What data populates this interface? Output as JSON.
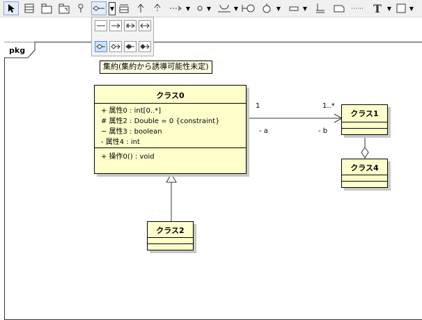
{
  "tooltip": {
    "text": "集約(集約から誘導可能性未定)"
  },
  "diagram": {
    "frame_label": "pkg",
    "classes": [
      {
        "name": "クラス0",
        "attributes": [
          "+ 属性0 : int[0..*]",
          "# 属性2 : Double = 0 {constraint}",
          "~ 属性3 : boolean",
          "- 属性4 : int"
        ],
        "operations": [
          "+ 操作0() : void"
        ]
      },
      {
        "name": "クラス1"
      },
      {
        "name": "クラス4"
      },
      {
        "name": "クラス2"
      }
    ],
    "association": {
      "source_multiplicity": "1",
      "target_multiplicity": "1..*",
      "source_role": "- a",
      "target_role": "- b"
    }
  },
  "colors": {
    "class_fill": "#ffffcc",
    "selected_tool": "#cfe3ff"
  }
}
